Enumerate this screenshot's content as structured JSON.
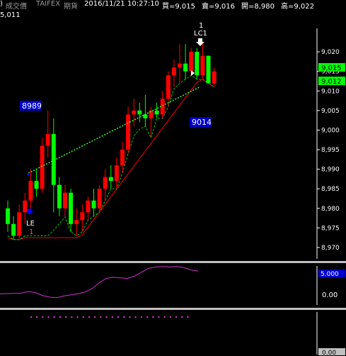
{
  "header": {
    "bracket": ")",
    "chart_type": "成交價",
    "symbol": "TAIFEX",
    "market": "期貨",
    "date": "2016/11/21",
    "time": "10:27:10",
    "bid": "買=9,015",
    "ask": "賣=9,016",
    "open": "開=8,980",
    "high": "高=9,022",
    "partial_low": "5,011"
  },
  "price_axis": {
    "ticks": [
      "9,020",
      "9,015",
      "9,010",
      "9,005",
      "9,000",
      "8,995",
      "8,990",
      "8,985",
      "8,980",
      "8,975",
      "8,970"
    ],
    "badge_bid": "9,015",
    "badge_ask": "9,012"
  },
  "annotations": {
    "label_8989": "8989",
    "label_9014": "9014",
    "lc_count": "1",
    "lc_label": "LC1",
    "le_label": "LE",
    "le_count": "1"
  },
  "indicator_axis": {
    "tick_zero": "0.00",
    "badge_value": "5.000"
  },
  "lower_axis": {
    "badge_value": "0.00"
  },
  "colors": {
    "up": "#ff0000",
    "down": "#00ff00",
    "badge_blue": "#0000cc",
    "oscillator": "#cc33cc",
    "guide_line": "#33ff33"
  },
  "chart_data": {
    "type": "candlestick",
    "ylim": [
      8968,
      9026
    ],
    "candles": [
      {
        "o": 8980,
        "h": 8982,
        "l": 8974,
        "c": 8976
      },
      {
        "o": 8976,
        "h": 8978,
        "l": 8972,
        "c": 8973
      },
      {
        "o": 8973,
        "h": 8981,
        "l": 8972,
        "c": 8979
      },
      {
        "o": 8979,
        "h": 8984,
        "l": 8976,
        "c": 8982
      },
      {
        "o": 8982,
        "h": 8990,
        "l": 8980,
        "c": 8987
      },
      {
        "o": 8987,
        "h": 8990,
        "l": 8983,
        "c": 8985
      },
      {
        "o": 8985,
        "h": 8998,
        "l": 8984,
        "c": 8996
      },
      {
        "o": 8996,
        "h": 9005,
        "l": 8993,
        "c": 8999
      },
      {
        "o": 8999,
        "h": 9003,
        "l": 8979,
        "c": 8986
      },
      {
        "o": 8986,
        "h": 8988,
        "l": 8978,
        "c": 8980
      },
      {
        "o": 8980,
        "h": 8986,
        "l": 8978,
        "c": 8984
      },
      {
        "o": 8984,
        "h": 8985,
        "l": 8974,
        "c": 8976
      },
      {
        "o": 8976,
        "h": 8980,
        "l": 8973,
        "c": 8977
      },
      {
        "o": 8977,
        "h": 8981,
        "l": 8974,
        "c": 8979
      },
      {
        "o": 8979,
        "h": 8983,
        "l": 8977,
        "c": 8982
      },
      {
        "o": 8982,
        "h": 8985,
        "l": 8978,
        "c": 8980
      },
      {
        "o": 8980,
        "h": 8986,
        "l": 8979,
        "c": 8985
      },
      {
        "o": 8985,
        "h": 8990,
        "l": 8982,
        "c": 8988
      },
      {
        "o": 8988,
        "h": 8991,
        "l": 8985,
        "c": 8987
      },
      {
        "o": 8987,
        "h": 8993,
        "l": 8985,
        "c": 8991
      },
      {
        "o": 8991,
        "h": 8997,
        "l": 8989,
        "c": 8995
      },
      {
        "o": 8995,
        "h": 9006,
        "l": 8994,
        "c": 9004
      },
      {
        "o": 9004,
        "h": 9008,
        "l": 9001,
        "c": 9005
      },
      {
        "o": 9005,
        "h": 9007,
        "l": 9002,
        "c": 9004
      },
      {
        "o": 9004,
        "h": 9009,
        "l": 9001,
        "c": 9003
      },
      {
        "o": 9003,
        "h": 9006,
        "l": 8998,
        "c": 9005
      },
      {
        "o": 9005,
        "h": 9007,
        "l": 9003,
        "c": 9004
      },
      {
        "o": 9004,
        "h": 9010,
        "l": 9003,
        "c": 9008
      },
      {
        "o": 9008,
        "h": 9015,
        "l": 9006,
        "c": 9014
      },
      {
        "o": 9014,
        "h": 9018,
        "l": 9011,
        "c": 9016
      },
      {
        "o": 9016,
        "h": 9022,
        "l": 9012,
        "c": 9017
      },
      {
        "o": 9017,
        "h": 9022,
        "l": 9013,
        "c": 9015
      },
      {
        "o": 9015,
        "h": 9021,
        "l": 9014,
        "c": 9020
      },
      {
        "o": 9020,
        "h": 9021,
        "l": 9013,
        "c": 9014
      },
      {
        "o": 9014,
        "h": 9022,
        "l": 9013,
        "c": 9019
      },
      {
        "o": 9019,
        "h": 9019,
        "l": 9012,
        "c": 9012
      },
      {
        "o": 9012,
        "h": 9016,
        "l": 9011,
        "c": 9015
      }
    ],
    "oscillator": [
      0.1,
      0.12,
      0.15,
      0.2,
      0.5,
      0.3,
      -0.2,
      -0.5,
      -0.6,
      -0.3,
      -0.1,
      0.1,
      0.4,
      1.0,
      2.0,
      2.8,
      3.0,
      2.9,
      2.8,
      3.2,
      3.9,
      4.6,
      4.8,
      4.9,
      4.8,
      4.9,
      4.7,
      4.3,
      4.1
    ]
  }
}
